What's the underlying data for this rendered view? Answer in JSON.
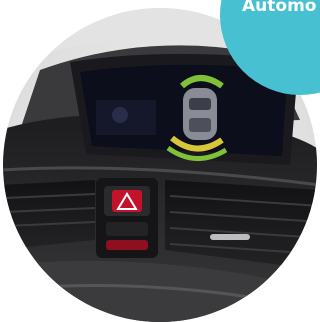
{
  "badge": {
    "label": "Automo",
    "color": "#47c0d2"
  },
  "colors": {
    "screen_bg": "#0c0e1c",
    "bezel": "#1a1a1e",
    "dashboard": "#2b2b2d",
    "hazard_red": "#c4122a",
    "sensor_green": "#7fc23a",
    "sensor_yellow": "#d9c53a"
  },
  "icons": {
    "hazard": "hazard-warning-icon",
    "car": "car-topview-icon"
  }
}
